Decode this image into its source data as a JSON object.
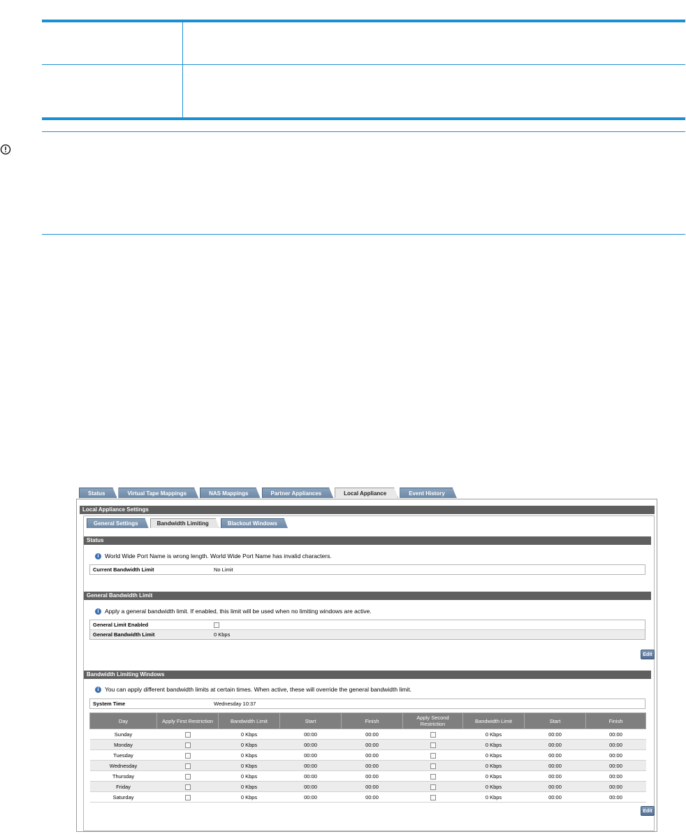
{
  "app": {
    "main_tabs": [
      "Status",
      "Virtual Tape Mappings",
      "NAS Mappings",
      "Partner Appliances",
      "Local Appliance",
      "Event History"
    ],
    "active_main_tab": "Local Appliance",
    "settings_title": "Local Appliance Settings",
    "sub_tabs": [
      "General Settings",
      "Bandwidth Limiting",
      "Blackout Windows"
    ],
    "active_sub_tab": "Bandwidth Limiting",
    "status": {
      "title": "Status",
      "info": "World Wide Port Name is wrong length. World Wide Port Name has invalid characters.",
      "current_limit_label": "Current Bandwidth Limit",
      "current_limit_value": "No Limit"
    },
    "general": {
      "title": "General Bandwidth Limit",
      "info": "Apply a general bandwidth limit. If enabled, this limit will be used when no limiting windows are active.",
      "enabled_label": "General Limit Enabled",
      "limit_label": "General Bandwidth Limit",
      "limit_value": "0 Kbps",
      "edit_label": "Edit"
    },
    "windows": {
      "title": "Bandwidth Limiting Windows",
      "info": "You can apply different bandwidth limits at certain times. When active, these will override the general bandwidth limit.",
      "system_time_label": "System Time",
      "system_time_value": "Wednesday 10:37",
      "columns": [
        "Day",
        "Apply First Restriction",
        "Bandwidth Limit",
        "Start",
        "Finish",
        "Apply Second Restriction",
        "Bandwidth Limit",
        "Start",
        "Finish"
      ],
      "rows": [
        {
          "day": "Sunday",
          "bw1": "0 Kbps",
          "start1": "00:00",
          "finish1": "00:00",
          "bw2": "0 Kbps",
          "start2": "00:00",
          "finish2": "00:00"
        },
        {
          "day": "Monday",
          "bw1": "0 Kbps",
          "start1": "00:00",
          "finish1": "00:00",
          "bw2": "0 Kbps",
          "start2": "00:00",
          "finish2": "00:00"
        },
        {
          "day": "Tuesday",
          "bw1": "0 Kbps",
          "start1": "00:00",
          "finish1": "00:00",
          "bw2": "0 Kbps",
          "start2": "00:00",
          "finish2": "00:00"
        },
        {
          "day": "Wednesday",
          "bw1": "0 Kbps",
          "start1": "00:00",
          "finish1": "00:00",
          "bw2": "0 Kbps",
          "start2": "00:00",
          "finish2": "00:00"
        },
        {
          "day": "Thursday",
          "bw1": "0 Kbps",
          "start1": "00:00",
          "finish1": "00:00",
          "bw2": "0 Kbps",
          "start2": "00:00",
          "finish2": "00:00"
        },
        {
          "day": "Friday",
          "bw1": "0 Kbps",
          "start1": "00:00",
          "finish1": "00:00",
          "bw2": "0 Kbps",
          "start2": "00:00",
          "finish2": "00:00"
        },
        {
          "day": "Saturday",
          "bw1": "0 Kbps",
          "start1": "00:00",
          "finish1": "00:00",
          "bw2": "0 Kbps",
          "start2": "00:00",
          "finish2": "00:00"
        }
      ],
      "edit_label": "Edit"
    }
  },
  "colors": {
    "doc_rule": "#1a8fd3",
    "tab_blue": "#6d88a6",
    "section_bar": "#5f5f5f",
    "grid_header": "#7f7f7f"
  },
  "icons": {
    "important": "exclamation-circle-icon",
    "info": "info-circle-icon"
  }
}
